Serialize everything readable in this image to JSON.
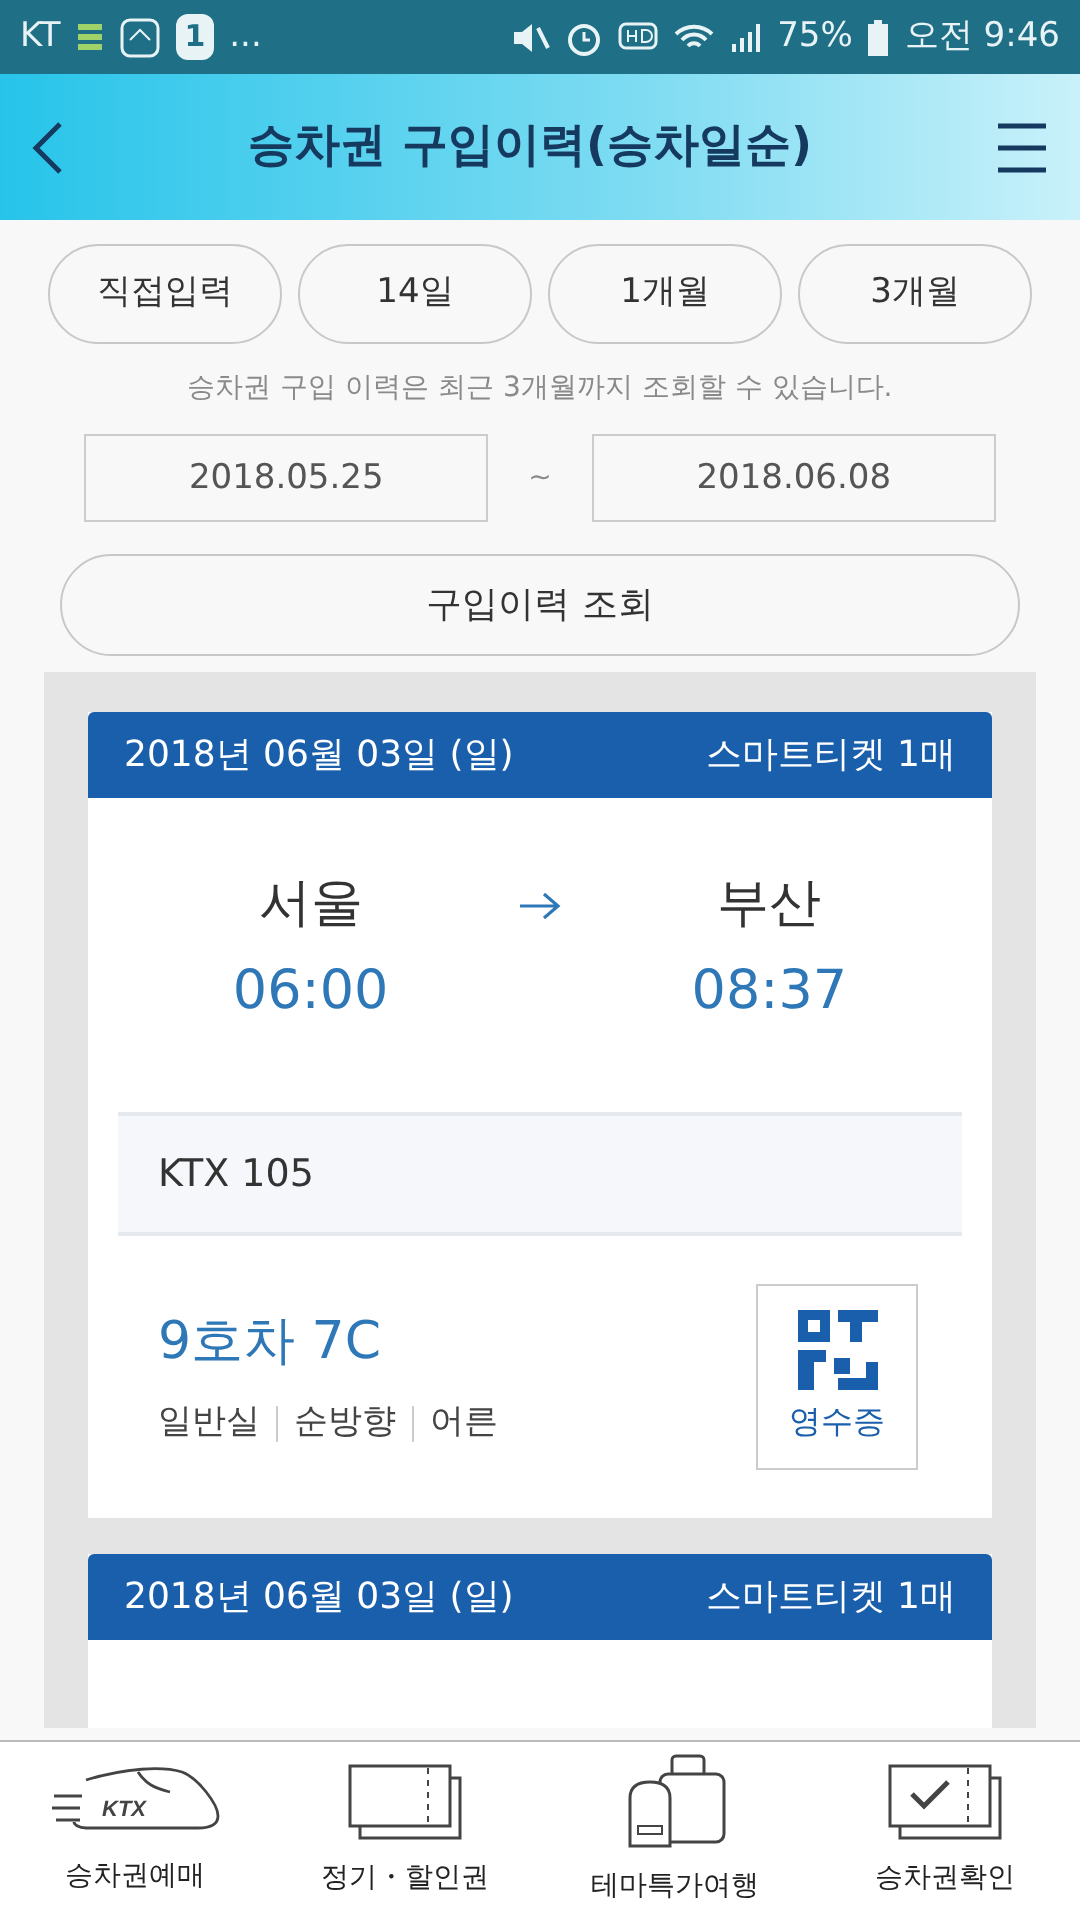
{
  "status_bar": {
    "carrier": "KT",
    "badge": "1",
    "more": "...",
    "battery": "75%",
    "time": "오전 9:46"
  },
  "header": {
    "title": "승차권 구입이력(승차일순)"
  },
  "periods": [
    {
      "label": "직접입력",
      "selected": false
    },
    {
      "label": "14일",
      "selected": false
    },
    {
      "label": "1개월",
      "selected": false
    },
    {
      "label": "3개월",
      "selected": false
    }
  ],
  "notice": "승차권 구입 이력은 최근 3개월까지 조회할 수 있습니다.",
  "date_range": {
    "from": "2018.05.25",
    "separator": "~",
    "to": "2018.06.08"
  },
  "search_button": "구입이력 조회",
  "tickets": [
    {
      "date": "2018년 06월 03일 (일)",
      "ticket_type": "스마트티켓 1매",
      "departure": "서울",
      "arrival": "부산",
      "departure_time": "06:00",
      "arrival_time": "08:37",
      "train": "KTX 105",
      "seat": "9호차 7C",
      "details": [
        "일반실",
        "순방향",
        "어른"
      ],
      "receipt": "영수증"
    },
    {
      "date": "2018년 06월 03일 (일)",
      "ticket_type": "스마트티켓 1매"
    }
  ],
  "bottom_nav": [
    {
      "kind": "train",
      "label": "승차권예매",
      "logo_text": "KTX"
    },
    {
      "kind": "tickets",
      "label": "정기・할인권"
    },
    {
      "kind": "luggage",
      "label": "테마특가여행"
    },
    {
      "kind": "check",
      "label": "승차권확인"
    }
  ]
}
